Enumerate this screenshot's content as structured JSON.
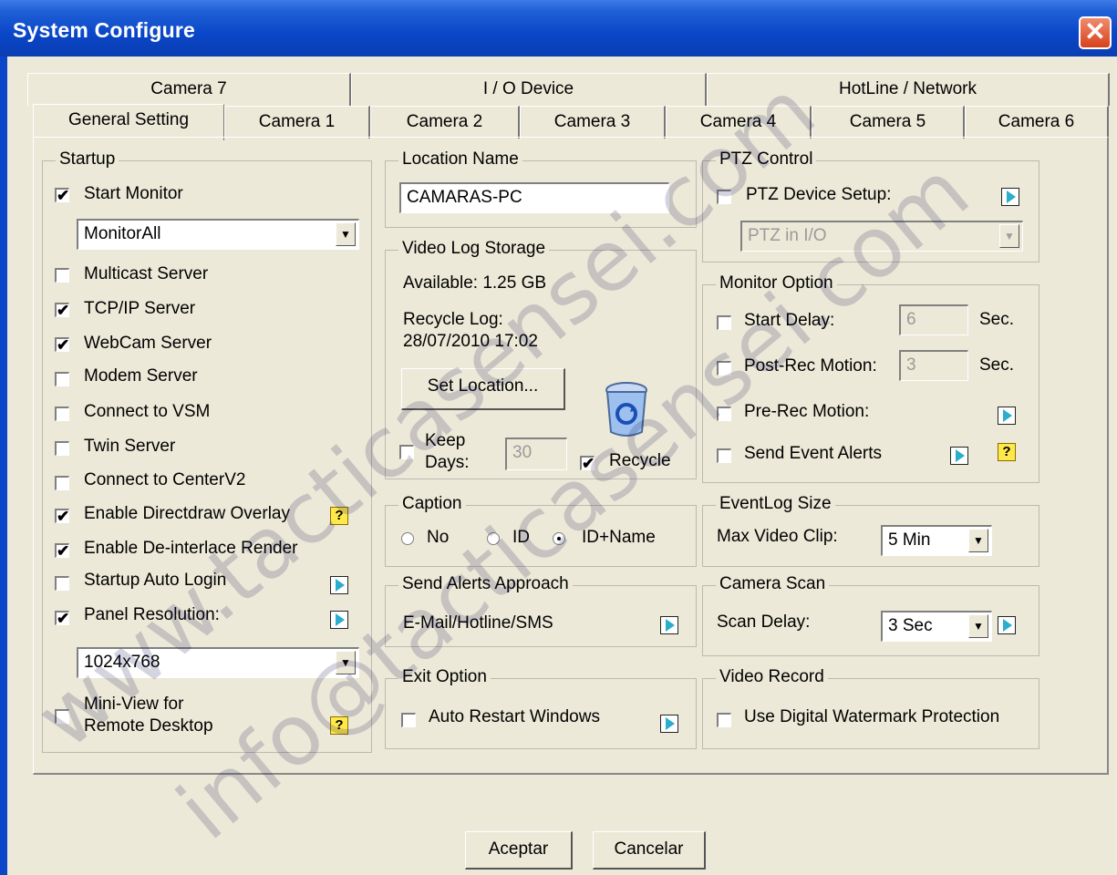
{
  "window": {
    "title": "System Configure",
    "close_glyph": "✕"
  },
  "tabs": {
    "row_back": [
      "Camera 7",
      "I / O Device",
      "HotLine / Network"
    ],
    "row_front": [
      "General Setting",
      "Camera 1",
      "Camera 2",
      "Camera 3",
      "Camera 4",
      "Camera 5",
      "Camera 6"
    ],
    "active": "General Setting"
  },
  "startup": {
    "title": "Startup",
    "start_monitor": {
      "label": "Start Monitor",
      "checked": true
    },
    "monitor_select": "MonitorAll",
    "items": [
      {
        "label": "Multicast Server",
        "checked": false
      },
      {
        "label": "TCP/IP Server",
        "checked": true
      },
      {
        "label": "WebCam Server",
        "checked": true
      },
      {
        "label": "Modem Server",
        "checked": false
      },
      {
        "label": "Connect to VSM",
        "checked": false
      },
      {
        "label": "Twin Server",
        "checked": false
      },
      {
        "label": "Connect to CenterV2",
        "checked": false
      },
      {
        "label": "Enable Directdraw Overlay",
        "checked": true
      },
      {
        "label": "Enable De-interlace Render",
        "checked": true
      },
      {
        "label": "Startup Auto Login",
        "checked": false
      },
      {
        "label": "Panel Resolution:",
        "checked": true
      }
    ],
    "resolution_select": "1024x768",
    "mini_view": {
      "label_line1": "Mini-View for",
      "label_line2": "Remote Desktop",
      "checked": false
    }
  },
  "location": {
    "title": "Location Name",
    "value": "CAMARAS-PC"
  },
  "storage": {
    "title": "Video Log Storage",
    "available": "Available: 1.25 GB",
    "recycle_log_label": "Recycle Log:",
    "recycle_log_value": "28/07/2010 17:02",
    "set_location_button": "Set Location...",
    "keep_days_line1": "Keep",
    "keep_days_line2": "Days:",
    "keep_days_value": "30",
    "keep_days_checked": false,
    "recycle_label": "Recycle",
    "recycle_checked": true
  },
  "caption": {
    "title": "Caption",
    "options": [
      "No",
      "ID",
      "ID+Name"
    ],
    "selected": "ID+Name"
  },
  "alerts": {
    "title": "Send Alerts Approach",
    "value": "E-Mail/Hotline/SMS"
  },
  "exit": {
    "title": "Exit Option",
    "auto_restart": "Auto Restart Windows",
    "checked": false
  },
  "ptz": {
    "title": "PTZ Control",
    "setup_label": "PTZ Device Setup:",
    "checked": false,
    "select": "PTZ in I/O"
  },
  "monitor_option": {
    "title": "Monitor Option",
    "start_delay": "Start Delay:",
    "start_delay_value": "6",
    "sec1": "Sec.",
    "post_rec": "Post-Rec Motion:",
    "post_rec_value": "3",
    "sec2": "Sec.",
    "pre_rec": "Pre-Rec Motion:",
    "send_event": "Send Event Alerts"
  },
  "eventlog": {
    "title": "EventLog Size",
    "label": "Max Video Clip:",
    "value": "5 Min"
  },
  "camera_scan": {
    "title": "Camera Scan",
    "label": "Scan Delay:",
    "value": "3 Sec"
  },
  "video_record": {
    "title": "Video Record",
    "label": "Use Digital Watermark Protection",
    "checked": false
  },
  "buttons": {
    "ok": "Aceptar",
    "cancel": "Cancelar"
  },
  "icons": {
    "play": "play-arrow-icon",
    "help": "help-icon",
    "recycle": "recycle-bin-icon",
    "check": "✔",
    "help_glyph": "?",
    "dropdown_glyph": "▼"
  },
  "watermarks": [
    "www.tacticasensei.com",
    "info@tacticasensei.com"
  ],
  "colors": {
    "title_bar": "#0a46c8",
    "dialog_bg": "#ece9d8",
    "close": "#d8411c",
    "help": "#ffe94a",
    "play": "#2aaecc"
  }
}
